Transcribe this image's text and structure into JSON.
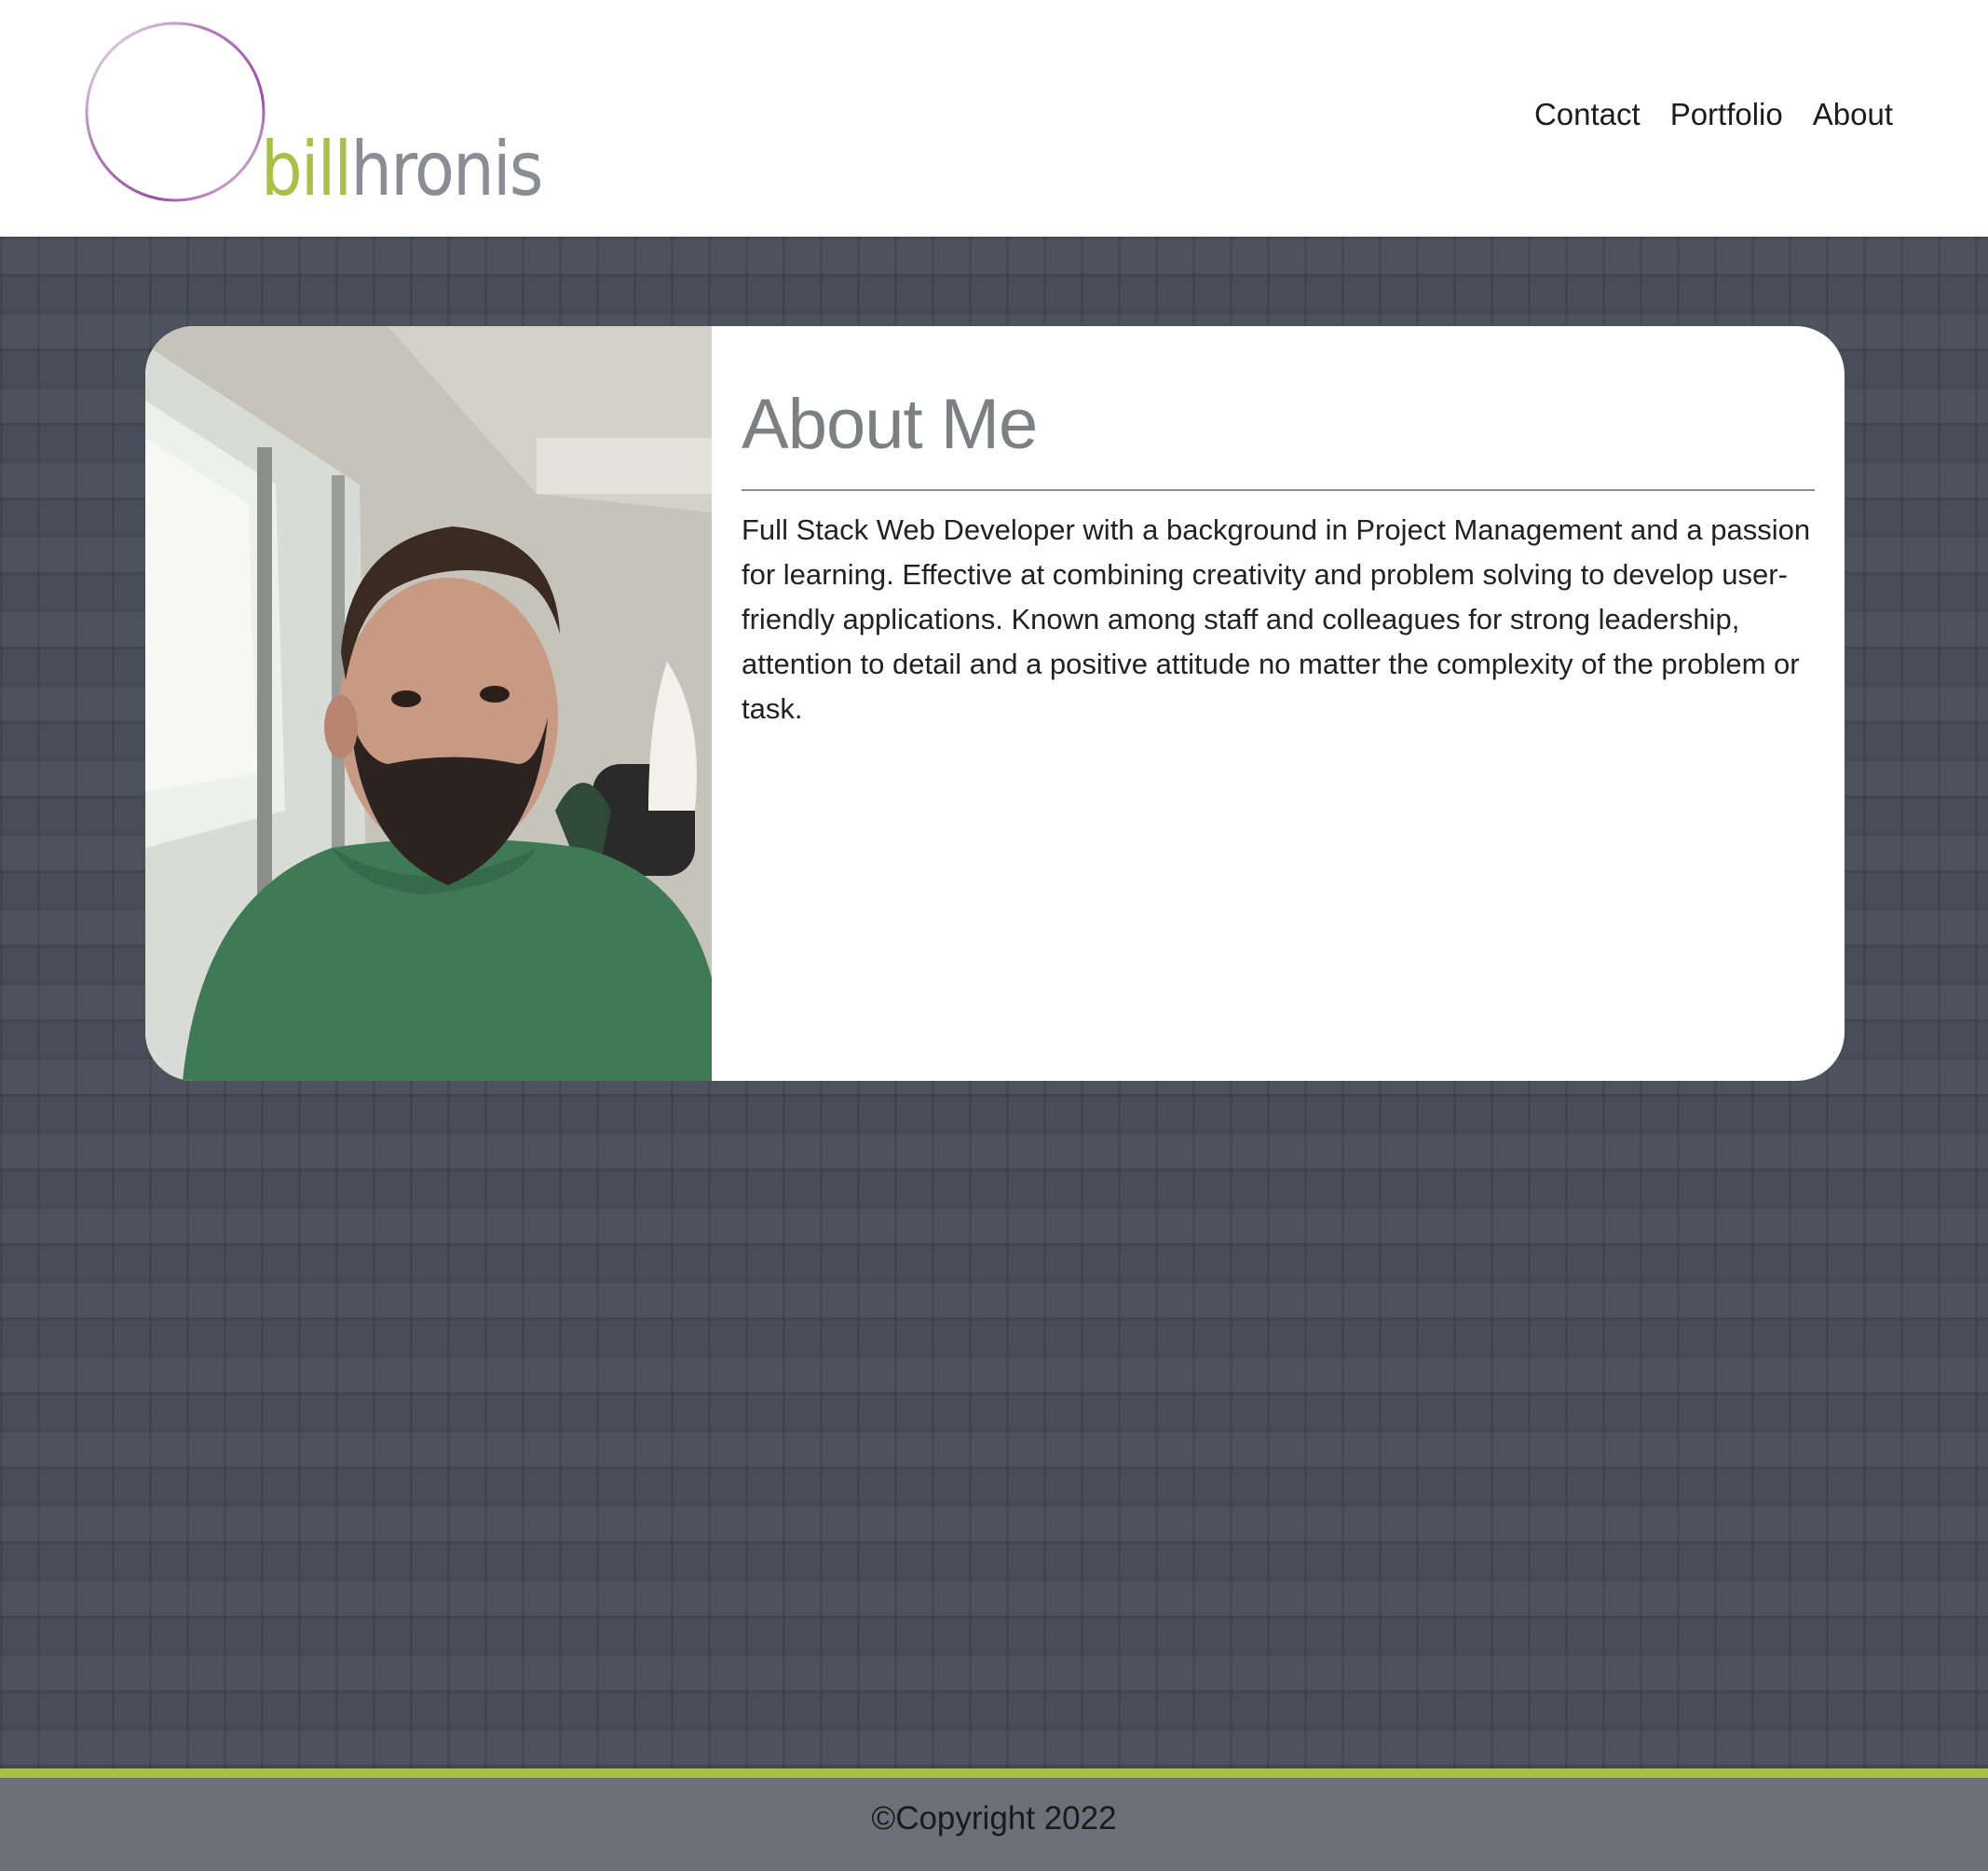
{
  "header": {
    "logo": {
      "first": "bill",
      "last": "hronis"
    },
    "nav": [
      {
        "label": "Contact"
      },
      {
        "label": "Portfolio"
      },
      {
        "label": "About"
      }
    ]
  },
  "about": {
    "title": "About Me",
    "body": "Full Stack Web Developer with a background in Project Management and a passion for learning. Effective at combining creativity and problem solving to develop user-friendly applications. Known among staff and colleagues for strong leadership, attention to detail and a positive attitude no matter the complexity of the problem or task."
  },
  "footer": {
    "copyright": "©Copyright 2022"
  },
  "colors": {
    "accent_green": "#a8c045",
    "accent_purple": "#9b4fa3",
    "background": "#474d59",
    "footer": "#6b7079"
  }
}
